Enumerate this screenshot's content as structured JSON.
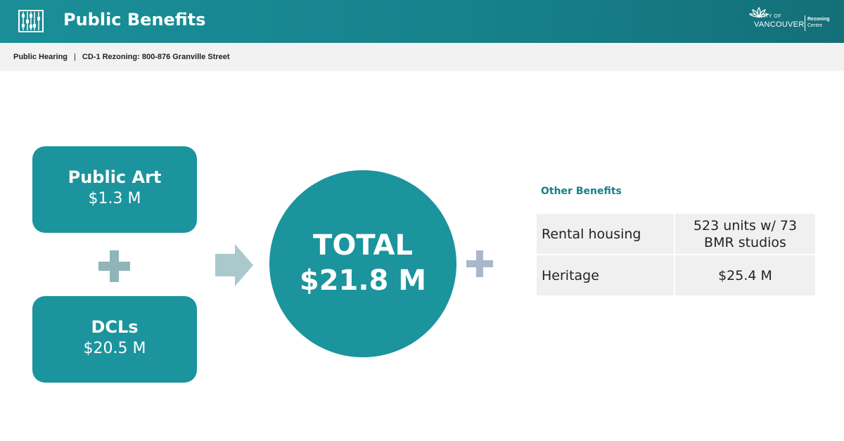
{
  "header": {
    "title": "Public Benefits",
    "logo": {
      "city_of": "CITY OF",
      "vancouver": "VANCOUVER",
      "rezoning": "Rezoning",
      "centre": "Centre"
    }
  },
  "breadcrumb": {
    "section": "Public Hearing",
    "separator": "|",
    "item": "CD-1 Rezoning: 800-876 Granville Street"
  },
  "benefits": {
    "public_art": {
      "label": "Public Art",
      "value": "$1.3 M"
    },
    "dcls": {
      "label": "DCLs",
      "value": "$20.5 M"
    }
  },
  "total": {
    "label": "TOTAL",
    "value": "$21.8 M"
  },
  "other_benefits": {
    "heading": "Other Benefits",
    "rows": [
      {
        "name": "Rental housing",
        "value_line1": "523 units w/ 73",
        "value_line2": "BMR studios"
      },
      {
        "name": "Heritage",
        "value_line1": "$25.4 M"
      }
    ]
  },
  "colors": {
    "header_teal": "#1a8f98",
    "box_teal": "#1b949d",
    "plus_gray": "#8fb5b8",
    "plus_blue_gray": "#a9b7c9",
    "arrow_light_teal": "#aac9cc",
    "heading_teal": "#1a7f88",
    "table_fill": "#f0f0f0"
  },
  "icons": {
    "app": "abacus-icon",
    "logo": "flower-icon",
    "plus": "plus-icon",
    "arrow": "arrow-right-icon"
  }
}
